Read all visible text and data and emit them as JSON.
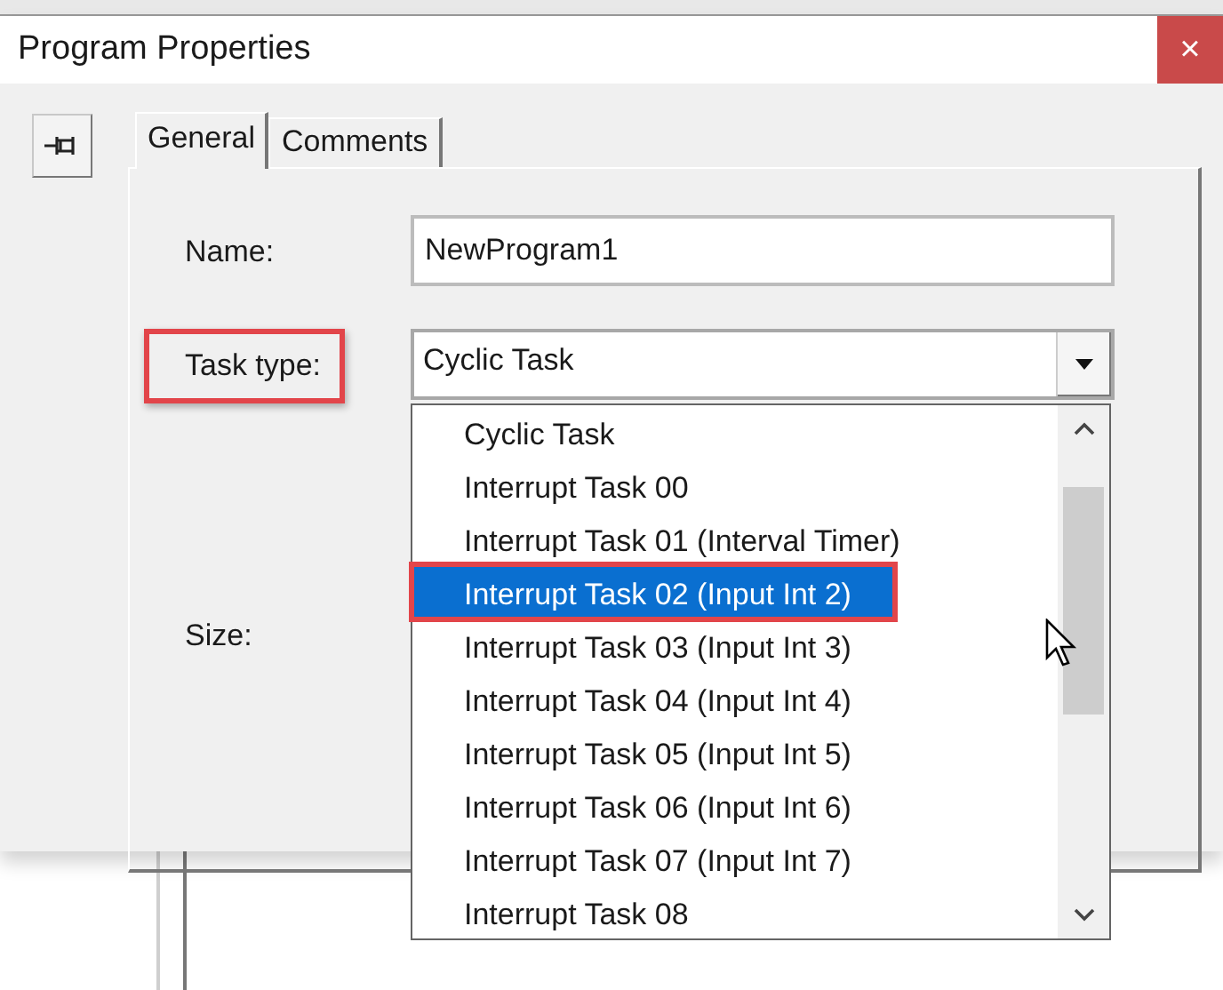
{
  "window": {
    "title": "Program Properties",
    "close": "×"
  },
  "tabs": [
    {
      "label": "General",
      "selected": true
    },
    {
      "label": "Comments",
      "selected": false
    }
  ],
  "form": {
    "name_label": "Name:",
    "name_value": "NewProgram1",
    "task_type_label": "Task type:",
    "task_type_annotated": true,
    "task_type_value": "Cyclic Task",
    "size_label": "Size:"
  },
  "dropdown": {
    "expanded": true,
    "items": [
      {
        "label": "Cyclic Task",
        "selected": false,
        "annotated": false
      },
      {
        "label": "Interrupt Task 00",
        "selected": false,
        "annotated": false
      },
      {
        "label": "Interrupt Task 01 (Interval Timer)",
        "selected": false,
        "annotated": false
      },
      {
        "label": "Interrupt Task 02 (Input Int 2)",
        "selected": true,
        "annotated": true
      },
      {
        "label": "Interrupt Task 03 (Input Int 3)",
        "selected": false,
        "annotated": false
      },
      {
        "label": "Interrupt Task 04 (Input Int 4)",
        "selected": false,
        "annotated": false
      },
      {
        "label": "Interrupt Task 05 (Input Int 5)",
        "selected": false,
        "annotated": false
      },
      {
        "label": "Interrupt Task 06 (Input Int 6)",
        "selected": false,
        "annotated": false
      },
      {
        "label": "Interrupt Task 07 (Input Int 7)",
        "selected": false,
        "annotated": false
      },
      {
        "label": "Interrupt Task 08",
        "selected": false,
        "annotated": false
      }
    ]
  }
}
